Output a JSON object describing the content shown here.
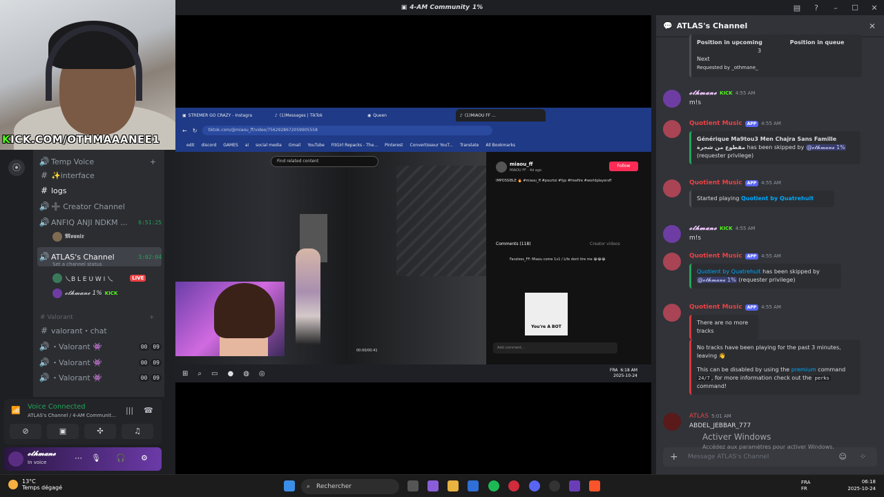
{
  "window": {
    "title": "4-AM Community",
    "title_suffix": "1%"
  },
  "webcam": {
    "banner_prefix": "K",
    "banner_text": "ICK.COM/OTHMAAANEE1"
  },
  "sidebar": {
    "items": [
      {
        "icon": "speaker-icon",
        "label": "Temp Voice",
        "kind": "category"
      },
      {
        "icon": "hash-icon",
        "label": "✨interface"
      },
      {
        "icon": "hash-icon",
        "label": "logs"
      },
      {
        "icon": "speaker-icon",
        "label": "➕ Creator Channel"
      },
      {
        "icon": "speaker-icon",
        "label": "ANFIQ ANJI NDKM ...",
        "time": "6:51:25"
      },
      {
        "icon": "speaker-icon",
        "label": "ATLAS's Channel",
        "time": "3:02:04",
        "status": "Set a channel status"
      }
    ],
    "mounir": "𝕸𝖔𝖚𝖓𝖎𝖗",
    "voice_users": [
      {
        "name": "乀B L E U W I 乀",
        "badge": "LIVE"
      },
      {
        "name": "𝓸𝓽𝓱𝓶𝓪𝓷𝓮 1%",
        "badge": "KICK"
      }
    ],
    "valorant_category": "Valorant",
    "valorant_chat": "valorant・chat",
    "valorant_rooms": [
      {
        "label": "・Valorant 👾",
        "count_a": "00",
        "count_b": "09"
      },
      {
        "label": "・Valorant 👾",
        "count_a": "00",
        "count_b": "09"
      },
      {
        "label": "・Valorant 👾",
        "count_a": "00",
        "count_b": "09"
      }
    ]
  },
  "voice_panel": {
    "status": "Voice Connected",
    "sub": "ATLAS's Channel / 4-AM Communit..."
  },
  "user_bar": {
    "name": "𝓸𝓽𝓱𝓶𝓪𝓷𝓮",
    "status": "In voice"
  },
  "stream": {
    "tabs": [
      "STREMER GO CRAZY - Instagra",
      "(1)Messages | TikTok",
      "Queen",
      "(1)MIAOU FF ..."
    ],
    "url": "tiktok.com/@miaou_ff/video/7562928672059905558",
    "bookmarks": [
      "edit",
      "discord",
      "GAMES",
      "ai",
      "social media",
      "Gmail",
      "YouTube",
      "FitGirl Repacks - The...",
      "Pinterest",
      "Convertisseur YouT...",
      "Translate",
      "All Bookmarks"
    ],
    "search_placeholder": "Find related content",
    "timecode": "00:00/00:41",
    "tt_user": "miaou_ff",
    "tt_sub": "MIAOU FF · 4d ago",
    "tt_follow": "Follow",
    "tt_caption": "IMPOSSIBLE 🔥 #miaou_ff #pourtoi #fyp #freefire #worldplayersff",
    "tt_comments": "Comments (118)",
    "tt_creator": "Creator videos",
    "tt_comment1": "Faceless_FF: Miaou come 1v1 / Life dont tire me 😂😂😂",
    "tt_bot": "You're A BOT",
    "tt_add": "Add comment...",
    "clock_time": "6:18 AM",
    "clock_date": "2025-10-24",
    "lang": "FRA"
  },
  "chat": {
    "header": "ATLAS's Channel",
    "top_embed": {
      "l1": "Position in upcoming",
      "l2": "Position in queue",
      "val": "3",
      "next": "Next",
      "requested": "Requested by _othmane_"
    },
    "messages": [
      {
        "user": "𝓸𝓽𝓱𝓶𝓪𝓷𝓮",
        "badge": "KICK",
        "time": "4:55 AM",
        "text": "m!s"
      },
      {
        "user": "Quotient Music",
        "app": "APP",
        "time": "4:55 AM",
        "embed_title": "Générique Ma9tou3 Men Chajra Sans Famille مقطوع من شجرة",
        "embed_text": "has been skipped by",
        "mention": "@𝓸𝓽𝓱𝓶𝓪𝓷𝓮 1%",
        "tail": "(requester privilege)"
      },
      {
        "user": "Quotient Music",
        "app": "APP",
        "time": "4:55 AM",
        "embed_text": "Started playing",
        "link": "Quotient by Quatrehuit"
      },
      {
        "user": "𝓸𝓽𝓱𝓶𝓪𝓷𝓮",
        "badge": "KICK",
        "time": "4:55 AM",
        "text": "m!s"
      },
      {
        "user": "Quotient Music",
        "app": "APP",
        "time": "4:55 AM",
        "link": "Quotient by Quatrehuit",
        "embed_text": "has been skipped by",
        "mention": "@𝓸𝓽𝓱𝓶𝓪𝓷𝓮 1%",
        "tail": "(requester privilege)"
      },
      {
        "user": "Quotient Music",
        "app": "APP",
        "time": "4:55 AM",
        "embed_text": "There are no more tracks",
        "embed2": "No tracks have been playing for the past 3 minutes, leaving 👋",
        "embed3a": "This can be disabled by using the",
        "embed3link": "premium",
        "embed3b": "command",
        "code1": "24/7",
        "embed3c": ", for more information check out the",
        "code2": "perks",
        "embed3d": "command!"
      },
      {
        "user": "ATLAS",
        "time": "5:01 AM",
        "text": "ABDEL_JEBBAR_777"
      }
    ],
    "input_placeholder": "Message ATLAS's Channel",
    "activate_title": "Activer Windows",
    "activate_sub": "Accédez aux paramètres pour activer Windows."
  },
  "taskbar": {
    "temp": "13°C",
    "weather": "Temps dégagé",
    "search": "Rechercher",
    "lang1": "FRA",
    "lang2": "FR",
    "time": "06:18",
    "date": "2025-10-24"
  }
}
